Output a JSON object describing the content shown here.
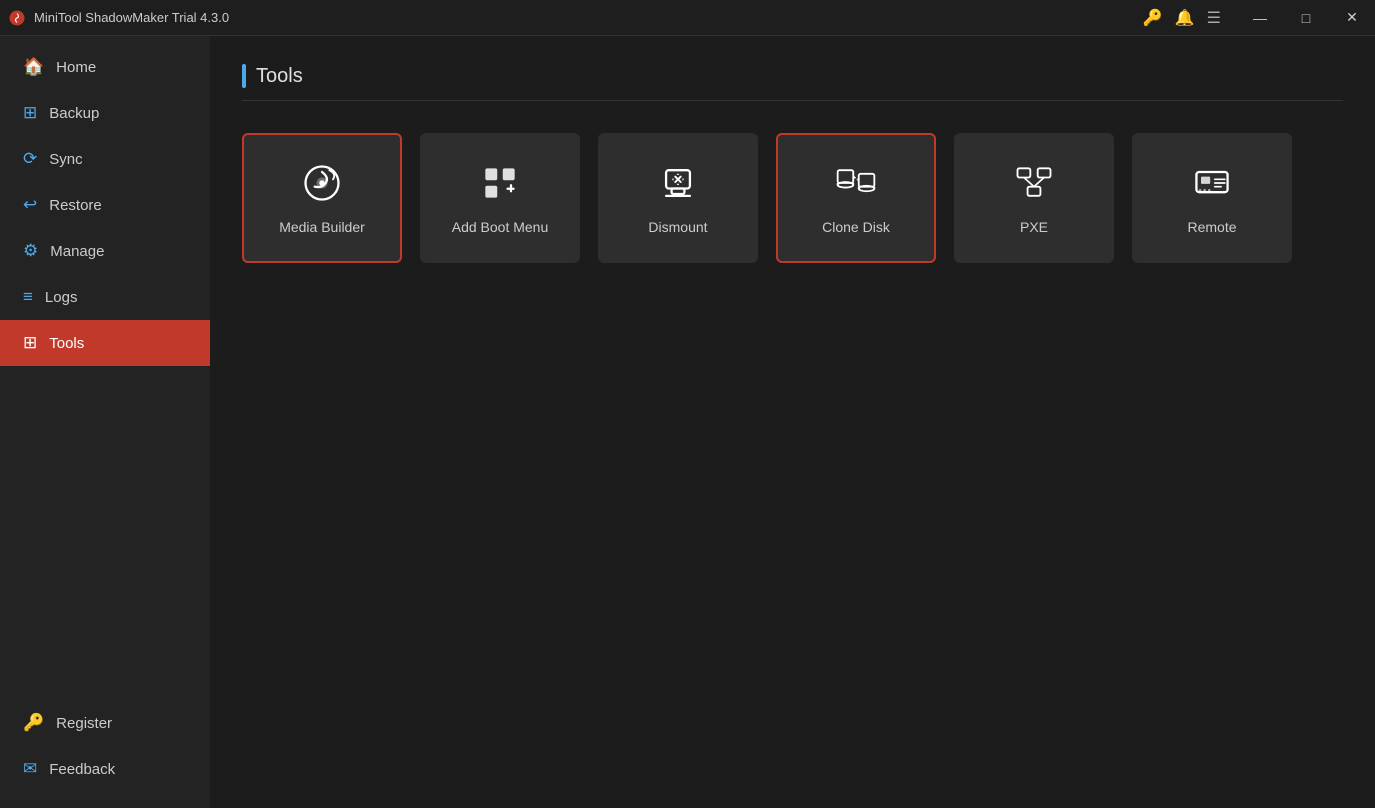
{
  "titleBar": {
    "title": "MiniTool ShadowMaker Trial 4.3.0",
    "controls": {
      "minimize": "—",
      "maximize": "□",
      "close": "✕"
    }
  },
  "sidebar": {
    "items": [
      {
        "id": "home",
        "label": "Home",
        "icon": "home"
      },
      {
        "id": "backup",
        "label": "Backup",
        "icon": "backup"
      },
      {
        "id": "sync",
        "label": "Sync",
        "icon": "sync"
      },
      {
        "id": "restore",
        "label": "Restore",
        "icon": "restore"
      },
      {
        "id": "manage",
        "label": "Manage",
        "icon": "manage"
      },
      {
        "id": "logs",
        "label": "Logs",
        "icon": "logs"
      },
      {
        "id": "tools",
        "label": "Tools",
        "icon": "tools",
        "active": true
      }
    ],
    "bottomItems": [
      {
        "id": "register",
        "label": "Register",
        "icon": "register"
      },
      {
        "id": "feedback",
        "label": "Feedback",
        "icon": "feedback"
      }
    ]
  },
  "content": {
    "pageTitle": "Tools",
    "tools": [
      {
        "id": "media-builder",
        "label": "Media Builder",
        "highlighted": true
      },
      {
        "id": "add-boot-menu",
        "label": "Add Boot Menu",
        "highlighted": false
      },
      {
        "id": "dismount",
        "label": "Dismount",
        "highlighted": false
      },
      {
        "id": "clone-disk",
        "label": "Clone Disk",
        "highlighted": true
      },
      {
        "id": "pxe",
        "label": "PXE",
        "highlighted": false
      },
      {
        "id": "remote",
        "label": "Remote",
        "highlighted": false
      }
    ]
  }
}
